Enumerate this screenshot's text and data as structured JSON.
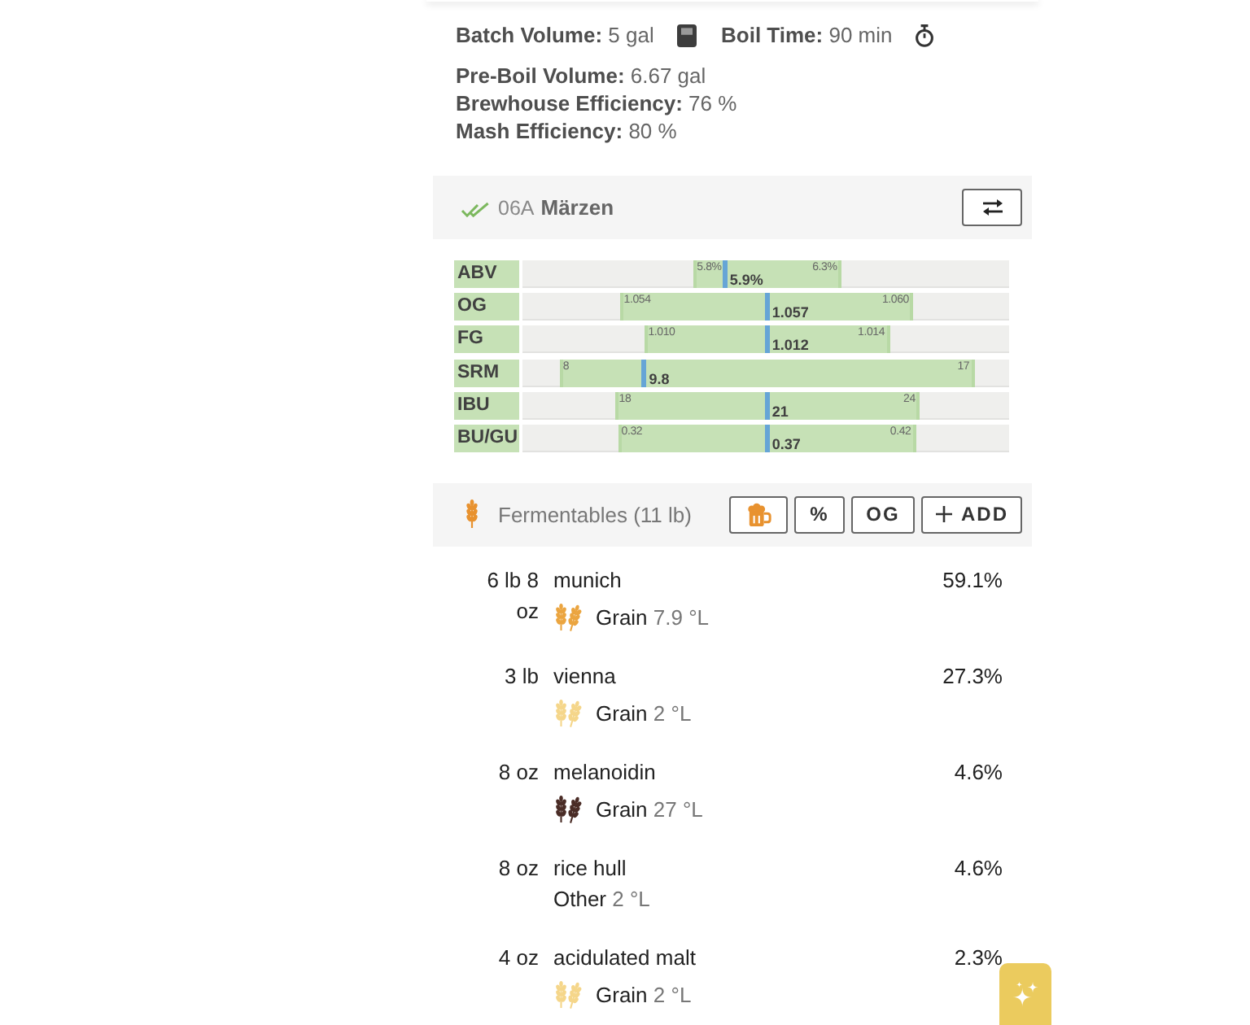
{
  "summary": {
    "items": [
      {
        "label": "Batch Volume:",
        "value": "5 gal",
        "kind": "volume"
      },
      {
        "label": "Boil Time:",
        "value": "90 min",
        "kind": "time"
      }
    ],
    "details": [
      {
        "label": "Pre-Boil Volume:",
        "value": "6.67 gal"
      },
      {
        "label": "Brewhouse Efficiency:",
        "value": "76 %"
      },
      {
        "label": "Mash Efficiency:",
        "value": "80 %"
      }
    ]
  },
  "style": {
    "code": "06A",
    "name": "Märzen"
  },
  "style_bars": [
    {
      "label": "ABV",
      "value": "5.9%",
      "level": 0.416,
      "range": [
        {
          "label": "5.8%",
          "level": 0.355
        },
        {
          "label": "6.3%",
          "level": 0.653
        }
      ]
    },
    {
      "label": "OG",
      "value": "1.057",
      "level": 0.503,
      "range": [
        {
          "label": "1.054",
          "level": 0.205
        },
        {
          "label": "1.060",
          "level": 0.801
        }
      ]
    },
    {
      "label": "FG",
      "value": "1.012",
      "level": 0.503,
      "range": [
        {
          "label": "1.010",
          "level": 0.255
        },
        {
          "label": "1.014",
          "level": 0.751
        }
      ]
    },
    {
      "label": "SRM",
      "value": "9.8",
      "level": 0.25,
      "range": [
        {
          "label": "8",
          "level": 0.08
        },
        {
          "label": "17",
          "level": 0.925
        }
      ]
    },
    {
      "label": "IBU",
      "value": "21",
      "level": 0.503,
      "range": [
        {
          "label": "18",
          "level": 0.195
        },
        {
          "label": "24",
          "level": 0.814
        }
      ]
    },
    {
      "label": "BU/GU",
      "value": "0.37",
      "level": 0.503,
      "range": [
        {
          "label": "0.32",
          "level": 0.2
        },
        {
          "label": "0.42",
          "level": 0.805
        }
      ]
    }
  ],
  "fermentables": {
    "title": "Fermentables (11 lb)",
    "buttons": [
      {
        "kind": "mug"
      },
      {
        "kind": "text",
        "label": "%"
      },
      {
        "kind": "text",
        "label": "OG"
      },
      {
        "kind": "add",
        "label": "ADD"
      }
    ],
    "items": [
      {
        "amount": "6 lb 8 oz",
        "name": "munich",
        "kind": "grain",
        "type": "Grain",
        "lovibond": "7.9 °L",
        "color": "#eba540",
        "percent": "59.1%"
      },
      {
        "amount": "3 lb",
        "name": "vienna",
        "kind": "grain",
        "type": "Grain",
        "lovibond": "2 °L",
        "color": "#f5d68a",
        "percent": "27.3%"
      },
      {
        "amount": "8 oz",
        "name": "melanoidin",
        "kind": "grain",
        "type": "Grain",
        "lovibond": "27 °L",
        "color": "#4a2c26",
        "percent": "4.6%"
      },
      {
        "amount": "8 oz",
        "name": "rice hull",
        "kind": "other",
        "type": "Other",
        "lovibond": "2 °L",
        "percent": "4.6%"
      },
      {
        "amount": "4 oz",
        "name": "acidulated malt",
        "kind": "grain",
        "type": "Grain",
        "lovibond": "2 °L",
        "color": "#f5d68a",
        "percent": "2.3%"
      }
    ]
  }
}
